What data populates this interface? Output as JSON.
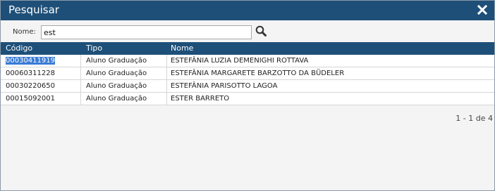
{
  "dialog": {
    "title": "Pesquisar"
  },
  "search": {
    "label": "Nome:",
    "value": "est"
  },
  "grid": {
    "columns": [
      "Código",
      "Tipo",
      "Nome"
    ],
    "rows": [
      {
        "codigo": "00030411919",
        "tipo": "Aluno Graduação",
        "nome": "ESTEFÂNIA LUZIA DEMENIGHI ROTTAVA"
      },
      {
        "codigo": "00060311228",
        "tipo": "Aluno Graduação",
        "nome": "ESTEFÂNIA MARGARETE BARZOTTO DA BÜDELER"
      },
      {
        "codigo": "00030220650",
        "tipo": "Aluno Graduação",
        "nome": "ESTEFÂNIA PARISOTTO LAGOA"
      },
      {
        "codigo": "00015092001",
        "tipo": "Aluno Graduação",
        "nome": "ESTER BARRETO"
      }
    ]
  },
  "pager": {
    "text": "1 - 1 de 4"
  },
  "colors": {
    "header": "#1e4f78",
    "selection": "#3a7bd5"
  },
  "icons": {
    "close": "close-icon",
    "search": "magnifier-icon"
  }
}
